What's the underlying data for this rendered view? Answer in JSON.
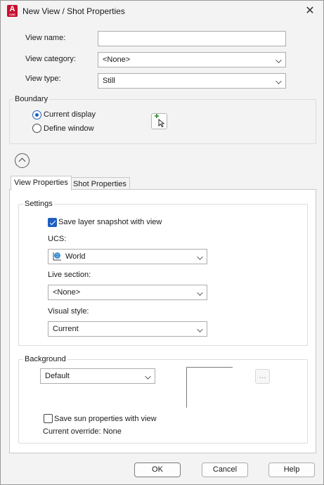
{
  "window": {
    "title": "New View / Shot Properties",
    "app_icon_letter": "A",
    "app_icon_sub": "CAD",
    "close_glyph": "✕"
  },
  "fields": {
    "view_name_label": "View name:",
    "view_name_value": "",
    "view_category_label": "View category:",
    "view_category_value": "<None>",
    "view_type_label": "View type:",
    "view_type_value": "Still"
  },
  "boundary": {
    "title": "Boundary",
    "current_display_label": "Current display",
    "define_window_label": "Define window",
    "selected": "current_display"
  },
  "tabs": [
    {
      "label": "View Properties",
      "active": true
    },
    {
      "label": "Shot Properties",
      "active": false
    }
  ],
  "settings": {
    "title": "Settings",
    "save_layer_snapshot_label": "Save layer snapshot with view",
    "save_layer_snapshot_checked": true,
    "ucs_label": "UCS:",
    "ucs_value": "World",
    "live_section_label": "Live section:",
    "live_section_value": "<None>",
    "visual_style_label": "Visual style:",
    "visual_style_value": "Current"
  },
  "background": {
    "title": "Background",
    "value": "Default",
    "browse_label": "...",
    "save_sun_label": "Save sun properties with view",
    "save_sun_checked": false,
    "current_override_label": "Current override: None"
  },
  "buttons": {
    "ok": "OK",
    "cancel": "Cancel",
    "help": "Help"
  },
  "colors": {
    "accent": "#1f5fbf",
    "app_icon": "#c8102e",
    "dialog_bg": "#f3f3f3"
  }
}
